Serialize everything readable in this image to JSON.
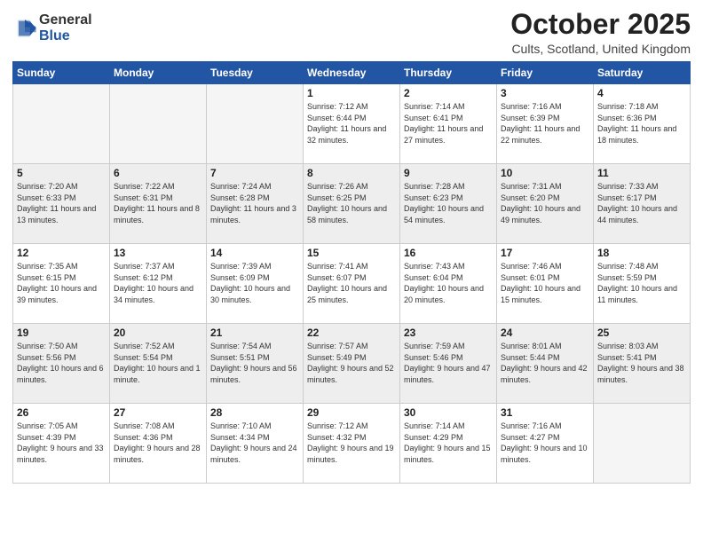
{
  "header": {
    "logo": {
      "general": "General",
      "blue": "Blue"
    },
    "title": "October 2025",
    "location": "Cults, Scotland, United Kingdom"
  },
  "weekdays": [
    "Sunday",
    "Monday",
    "Tuesday",
    "Wednesday",
    "Thursday",
    "Friday",
    "Saturday"
  ],
  "weeks": [
    [
      {
        "day": null,
        "empty": true
      },
      {
        "day": null,
        "empty": true
      },
      {
        "day": null,
        "empty": true
      },
      {
        "day": 1,
        "sunrise": "7:12 AM",
        "sunset": "6:44 PM",
        "daylight": "11 hours and 32 minutes."
      },
      {
        "day": 2,
        "sunrise": "7:14 AM",
        "sunset": "6:41 PM",
        "daylight": "11 hours and 27 minutes."
      },
      {
        "day": 3,
        "sunrise": "7:16 AM",
        "sunset": "6:39 PM",
        "daylight": "11 hours and 22 minutes."
      },
      {
        "day": 4,
        "sunrise": "7:18 AM",
        "sunset": "6:36 PM",
        "daylight": "11 hours and 18 minutes."
      }
    ],
    [
      {
        "day": 5,
        "sunrise": "7:20 AM",
        "sunset": "6:33 PM",
        "daylight": "11 hours and 13 minutes."
      },
      {
        "day": 6,
        "sunrise": "7:22 AM",
        "sunset": "6:31 PM",
        "daylight": "11 hours and 8 minutes."
      },
      {
        "day": 7,
        "sunrise": "7:24 AM",
        "sunset": "6:28 PM",
        "daylight": "11 hours and 3 minutes."
      },
      {
        "day": 8,
        "sunrise": "7:26 AM",
        "sunset": "6:25 PM",
        "daylight": "10 hours and 58 minutes."
      },
      {
        "day": 9,
        "sunrise": "7:28 AM",
        "sunset": "6:23 PM",
        "daylight": "10 hours and 54 minutes."
      },
      {
        "day": 10,
        "sunrise": "7:31 AM",
        "sunset": "6:20 PM",
        "daylight": "10 hours and 49 minutes."
      },
      {
        "day": 11,
        "sunrise": "7:33 AM",
        "sunset": "6:17 PM",
        "daylight": "10 hours and 44 minutes."
      }
    ],
    [
      {
        "day": 12,
        "sunrise": "7:35 AM",
        "sunset": "6:15 PM",
        "daylight": "10 hours and 39 minutes."
      },
      {
        "day": 13,
        "sunrise": "7:37 AM",
        "sunset": "6:12 PM",
        "daylight": "10 hours and 34 minutes."
      },
      {
        "day": 14,
        "sunrise": "7:39 AM",
        "sunset": "6:09 PM",
        "daylight": "10 hours and 30 minutes."
      },
      {
        "day": 15,
        "sunrise": "7:41 AM",
        "sunset": "6:07 PM",
        "daylight": "10 hours and 25 minutes."
      },
      {
        "day": 16,
        "sunrise": "7:43 AM",
        "sunset": "6:04 PM",
        "daylight": "10 hours and 20 minutes."
      },
      {
        "day": 17,
        "sunrise": "7:46 AM",
        "sunset": "6:01 PM",
        "daylight": "10 hours and 15 minutes."
      },
      {
        "day": 18,
        "sunrise": "7:48 AM",
        "sunset": "5:59 PM",
        "daylight": "10 hours and 11 minutes."
      }
    ],
    [
      {
        "day": 19,
        "sunrise": "7:50 AM",
        "sunset": "5:56 PM",
        "daylight": "10 hours and 6 minutes."
      },
      {
        "day": 20,
        "sunrise": "7:52 AM",
        "sunset": "5:54 PM",
        "daylight": "10 hours and 1 minute."
      },
      {
        "day": 21,
        "sunrise": "7:54 AM",
        "sunset": "5:51 PM",
        "daylight": "9 hours and 56 minutes."
      },
      {
        "day": 22,
        "sunrise": "7:57 AM",
        "sunset": "5:49 PM",
        "daylight": "9 hours and 52 minutes."
      },
      {
        "day": 23,
        "sunrise": "7:59 AM",
        "sunset": "5:46 PM",
        "daylight": "9 hours and 47 minutes."
      },
      {
        "day": 24,
        "sunrise": "8:01 AM",
        "sunset": "5:44 PM",
        "daylight": "9 hours and 42 minutes."
      },
      {
        "day": 25,
        "sunrise": "8:03 AM",
        "sunset": "5:41 PM",
        "daylight": "9 hours and 38 minutes."
      }
    ],
    [
      {
        "day": 26,
        "sunrise": "7:05 AM",
        "sunset": "4:39 PM",
        "daylight": "9 hours and 33 minutes."
      },
      {
        "day": 27,
        "sunrise": "7:08 AM",
        "sunset": "4:36 PM",
        "daylight": "9 hours and 28 minutes."
      },
      {
        "day": 28,
        "sunrise": "7:10 AM",
        "sunset": "4:34 PM",
        "daylight": "9 hours and 24 minutes."
      },
      {
        "day": 29,
        "sunrise": "7:12 AM",
        "sunset": "4:32 PM",
        "daylight": "9 hours and 19 minutes."
      },
      {
        "day": 30,
        "sunrise": "7:14 AM",
        "sunset": "4:29 PM",
        "daylight": "9 hours and 15 minutes."
      },
      {
        "day": 31,
        "sunrise": "7:16 AM",
        "sunset": "4:27 PM",
        "daylight": "9 hours and 10 minutes."
      },
      {
        "day": null,
        "empty": true
      }
    ]
  ],
  "labels": {
    "sunrise": "Sunrise:",
    "sunset": "Sunset:",
    "daylight": "Daylight hours"
  }
}
